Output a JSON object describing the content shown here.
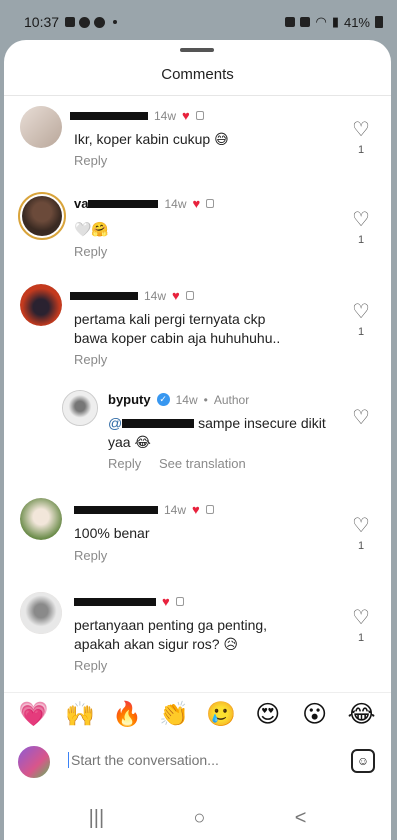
{
  "status": {
    "time": "10:37",
    "battery": "41%"
  },
  "sheet": {
    "title": "Comments"
  },
  "comments": [
    {
      "text": "Ikr, koper kabin cukup 😅",
      "time": "14w",
      "reply": "Reply",
      "likes": "1"
    },
    {
      "name_prefix": "va",
      "time": "14w",
      "text": "🤍🤗",
      "reply": "Reply",
      "likes": "1"
    },
    {
      "time": "14w",
      "text_line1": "pertama kali pergi ternyata ckp",
      "text_line2": "bawa koper cabin aja huhuhuhu..",
      "reply": "Reply",
      "likes": "1"
    },
    {
      "username": "byputy",
      "time": "14w",
      "author_label": "Author",
      "mention": "@",
      "text_line1": "sampe insecure dikit",
      "text_line2": "yaa 😂",
      "reply": "Reply",
      "see_translation": "See translation"
    },
    {
      "time": "14w",
      "text": "100% benar",
      "reply": "Reply",
      "likes": "1"
    },
    {
      "text_line1": "pertanyaan penting ga penting,",
      "text_line2": "apakah akan sigur ros? 😥",
      "reply": "Reply",
      "likes": "1"
    }
  ],
  "reactions": [
    "💗",
    "🙌",
    "🔥",
    "👏",
    "🥲",
    "😍",
    "😮",
    "😂"
  ],
  "composer": {
    "placeholder": "Start the conversation..."
  },
  "icons": {
    "heart": "heart-outline-icon",
    "sticker": "sticker-icon"
  },
  "nav": {
    "recents": "|||",
    "home": "○",
    "back": "<"
  },
  "colors": {
    "like_red": "#e8223d",
    "verified_blue": "#3897f0",
    "story_ring": "#d9a43b"
  }
}
